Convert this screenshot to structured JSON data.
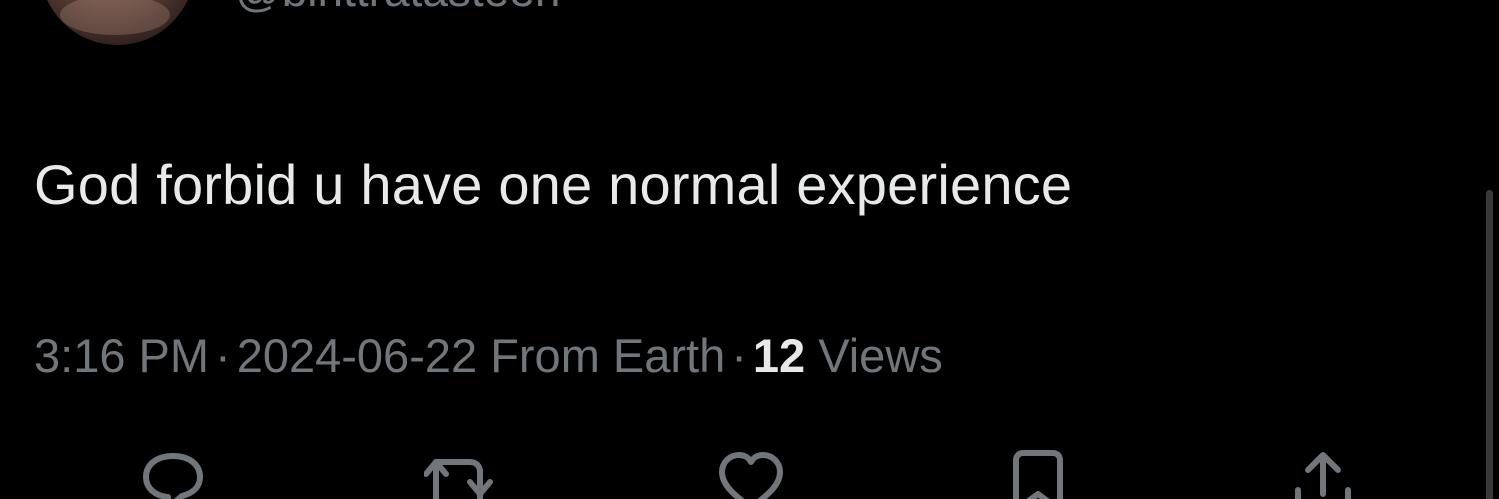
{
  "author": {
    "handle": "@binttratasteen",
    "avatar_icon": "profile-avatar"
  },
  "tweet": {
    "text": "God forbid u have one normal experience"
  },
  "meta": {
    "time": "3:16 PM",
    "separator": "·",
    "date": "2024-06-22",
    "source": "From Earth",
    "views_count": "12",
    "views_label": "Views"
  },
  "actions": [
    {
      "icon": "reply-icon"
    },
    {
      "icon": "retweet-icon"
    },
    {
      "icon": "like-icon"
    },
    {
      "icon": "bookmark-icon"
    },
    {
      "icon": "share-icon"
    }
  ],
  "colors": {
    "background": "#000000",
    "text": "#e7e9ea",
    "secondary_text": "#71767b"
  }
}
